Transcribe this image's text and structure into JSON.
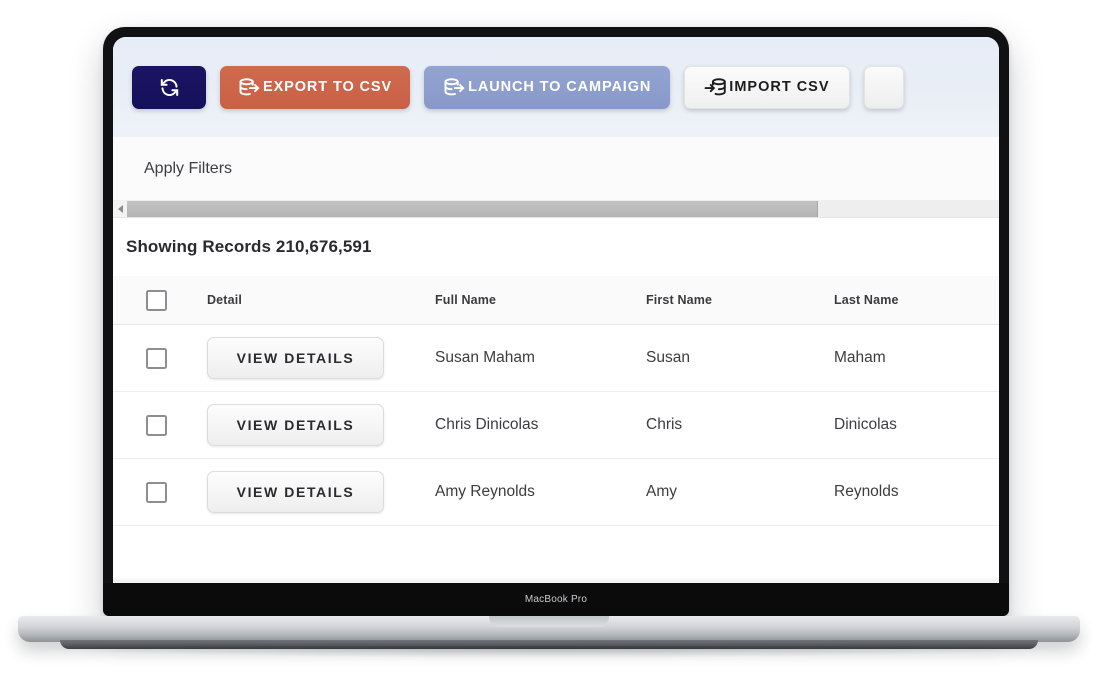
{
  "device": {
    "brand": "MacBook Pro"
  },
  "toolbar": {
    "refresh_icon": "refresh-sync-icon",
    "buttons": [
      {
        "id": "export",
        "label": "EXPORT TO CSV",
        "icon": "database-export-icon",
        "color": "#cb6249"
      },
      {
        "id": "launch",
        "label": "LAUNCH TO CAMPAIGN",
        "icon": "database-launch-icon",
        "color": "#8b9bcb"
      },
      {
        "id": "import",
        "label": "IMPORT CSV",
        "icon": "database-import-icon",
        "color": "#f3f3f3"
      }
    ]
  },
  "filters": {
    "label": "Apply Filters"
  },
  "scrollbar": {
    "arrow_icon": "chevron-left-icon"
  },
  "records": {
    "label": "Showing Records 210,676,591"
  },
  "table": {
    "columns": [
      "Detail",
      "Full Name",
      "First Name",
      "Last Name"
    ],
    "detail_button_label": "VIEW DETAILS",
    "rows": [
      {
        "full_name": "Susan Maham",
        "first_name": "Susan",
        "last_name": "Maham"
      },
      {
        "full_name": "Chris Dinicolas",
        "first_name": "Chris",
        "last_name": "Dinicolas"
      },
      {
        "full_name": "Amy Reynolds",
        "first_name": "Amy",
        "last_name": "Reynolds"
      }
    ]
  }
}
